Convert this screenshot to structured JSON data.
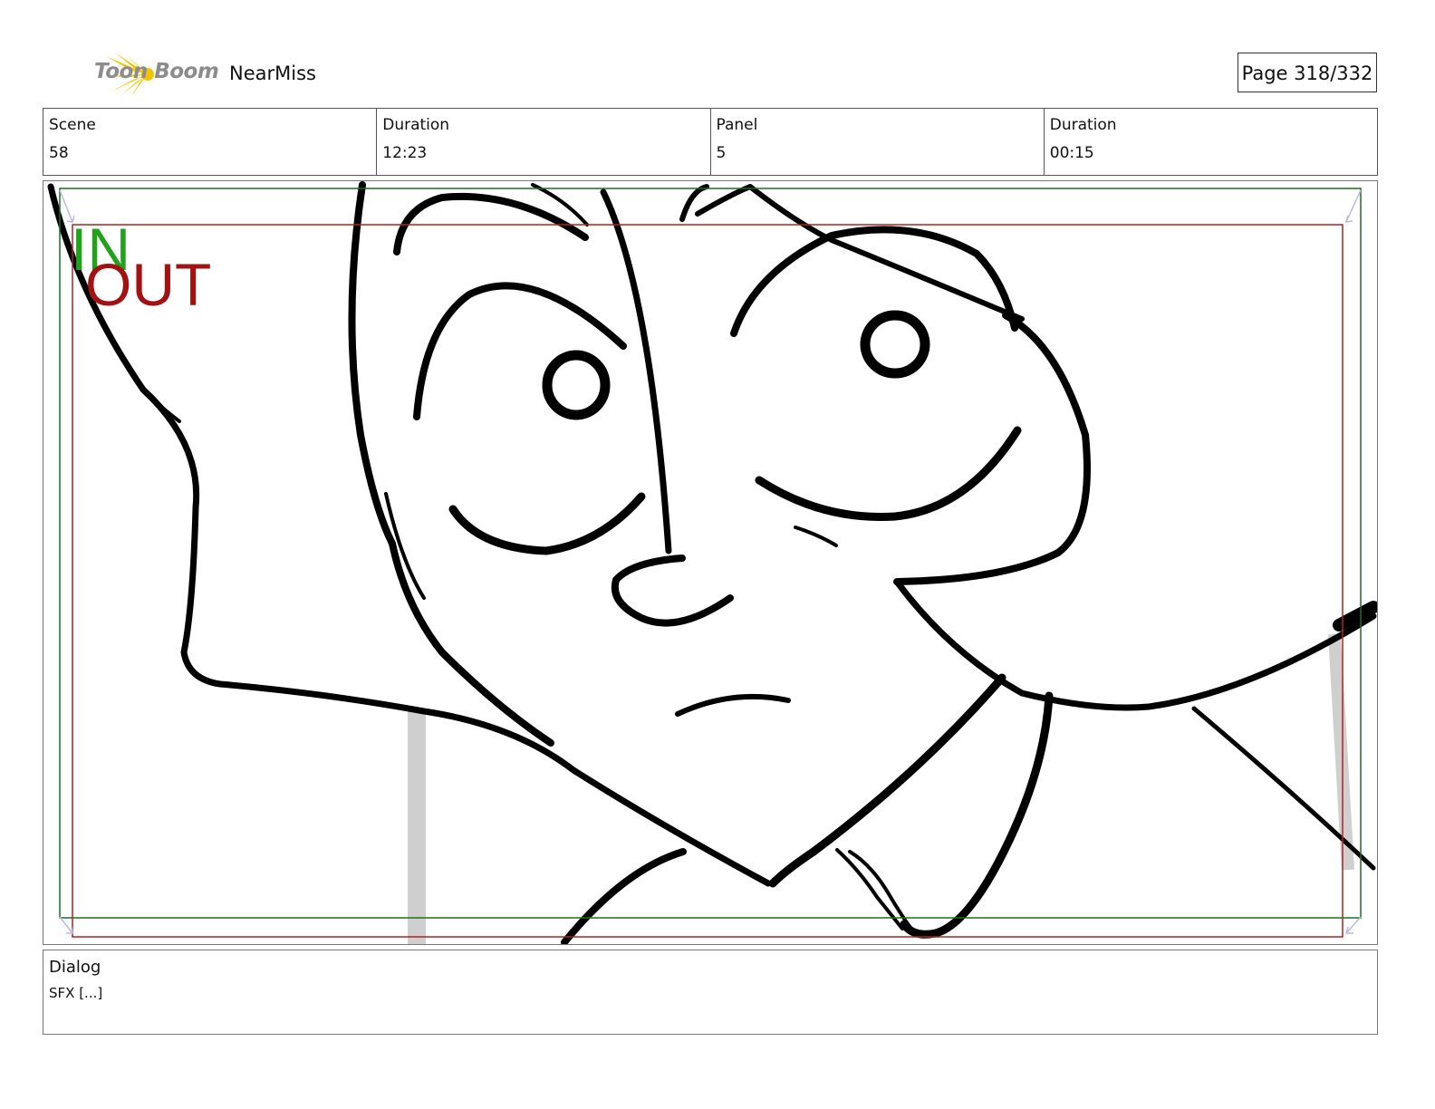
{
  "header": {
    "logo_text": "Toon Boom",
    "project_title": "NearMiss",
    "page_indicator": "Page 318/332"
  },
  "info": {
    "scene_label": "Scene",
    "scene_value": "58",
    "scene_duration_label": "Duration",
    "scene_duration_value": "12:23",
    "panel_label": "Panel",
    "panel_value": "5",
    "panel_duration_label": "Duration",
    "panel_duration_value": "00:15"
  },
  "panel": {
    "in_marker": "IN",
    "out_marker": "OUT",
    "in_color": "#22a11a",
    "out_color": "#a31212"
  },
  "dialog": {
    "label": "Dialog",
    "text": "SFX [...]"
  },
  "colors": {
    "logo_star": "#f5c400",
    "safe_frame_in": "#1f6e1f",
    "safe_frame_out": "#b22222"
  }
}
